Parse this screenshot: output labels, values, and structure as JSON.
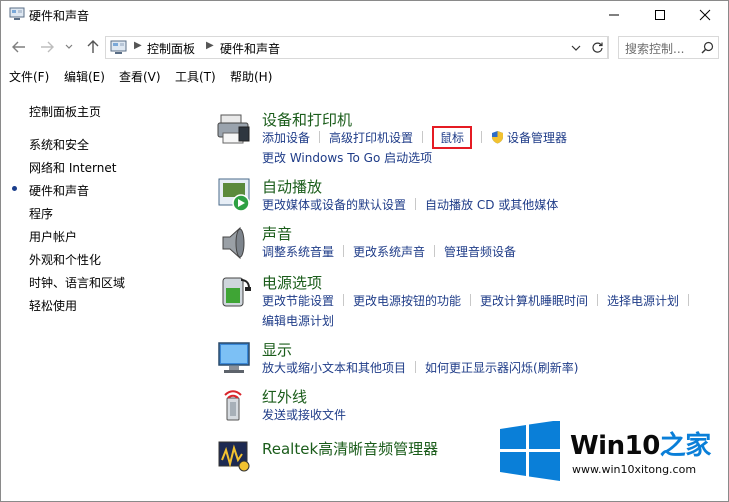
{
  "window": {
    "title": "硬件和声音"
  },
  "address": {
    "crumbs": [
      "控制面板",
      "硬件和声音"
    ],
    "search_placeholder": "搜索控制..."
  },
  "menu": [
    "文件(F)",
    "编辑(E)",
    "查看(V)",
    "工具(T)",
    "帮助(H)"
  ],
  "sidebar": {
    "home": "控制面板主页",
    "items": [
      "系统和安全",
      "网络和 Internet",
      "硬件和声音",
      "程序",
      "用户帐户",
      "外观和个性化",
      "时钟、语言和区域",
      "轻松使用"
    ],
    "active_index": 2
  },
  "categories": [
    {
      "title": "设备和打印机",
      "rows": [
        [
          "添加设备",
          "高级打印机设置",
          "鼠标",
          "设备管理器"
        ],
        [
          "更改 Windows To Go 启动选项"
        ]
      ],
      "highlighted": "鼠标"
    },
    {
      "title": "自动播放",
      "rows": [
        [
          "更改媒体或设备的默认设置",
          "自动播放 CD 或其他媒体"
        ]
      ]
    },
    {
      "title": "声音",
      "rows": [
        [
          "调整系统音量",
          "更改系统声音",
          "管理音频设备"
        ]
      ]
    },
    {
      "title": "电源选项",
      "rows": [
        [
          "更改节能设置",
          "更改电源按钮的功能",
          "更改计算机睡眠时间",
          "选择电源计划"
        ],
        [
          "编辑电源计划"
        ]
      ]
    },
    {
      "title": "显示",
      "rows": [
        [
          "放大或缩小文本和其他项目",
          "如何更正显示器闪烁(刷新率)"
        ]
      ]
    },
    {
      "title": "红外线",
      "rows": [
        [
          "发送或接收文件"
        ]
      ]
    },
    {
      "title": "Realtek高清晰音频管理器",
      "rows": []
    }
  ],
  "watermark": {
    "brand": "Win10",
    "brand_suffix": "之家",
    "url": "www.win10xitong.com"
  },
  "colors": {
    "link": "#1f3c88",
    "category_title": "#1a5c1a",
    "highlight": "#e51b23",
    "win_blue": "#0a7fd8"
  }
}
